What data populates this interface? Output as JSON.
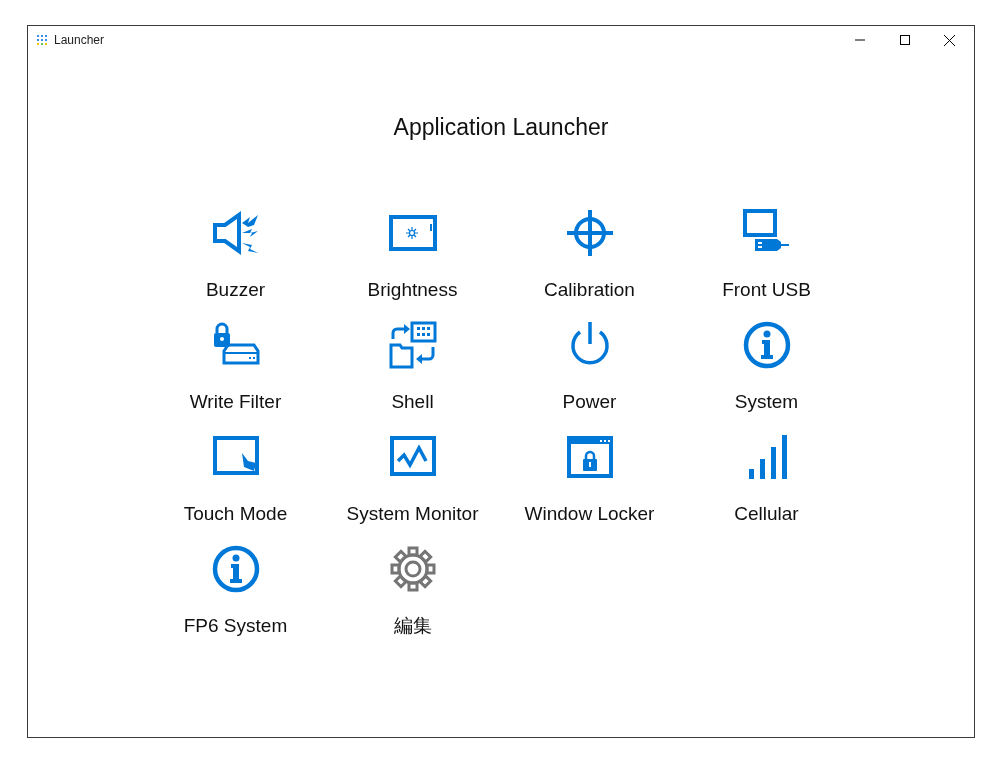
{
  "window": {
    "title": "Launcher",
    "controls": [
      {
        "kind": "minimize"
      },
      {
        "kind": "maximize"
      },
      {
        "kind": "close"
      }
    ]
  },
  "heading": "Application Launcher",
  "apps": [
    {
      "label": "Buzzer",
      "kind": "speaker"
    },
    {
      "label": "Brightness",
      "kind": "brightness"
    },
    {
      "label": "Calibration",
      "kind": "crosshair"
    },
    {
      "label": "Front USB",
      "kind": "usb"
    },
    {
      "label": "Write Filter",
      "kind": "lockdrive"
    },
    {
      "label": "Shell",
      "kind": "shell"
    },
    {
      "label": "Power",
      "kind": "power"
    },
    {
      "label": "System",
      "kind": "info"
    },
    {
      "label": "Touch Mode",
      "kind": "touch"
    },
    {
      "label": "System Monitor",
      "kind": "monitor"
    },
    {
      "label": "Window Locker",
      "kind": "windowlock"
    },
    {
      "label": "Cellular",
      "kind": "signal"
    },
    {
      "label": "FP6 System",
      "kind": "info"
    },
    {
      "label": "編集",
      "kind": "gear"
    }
  ]
}
